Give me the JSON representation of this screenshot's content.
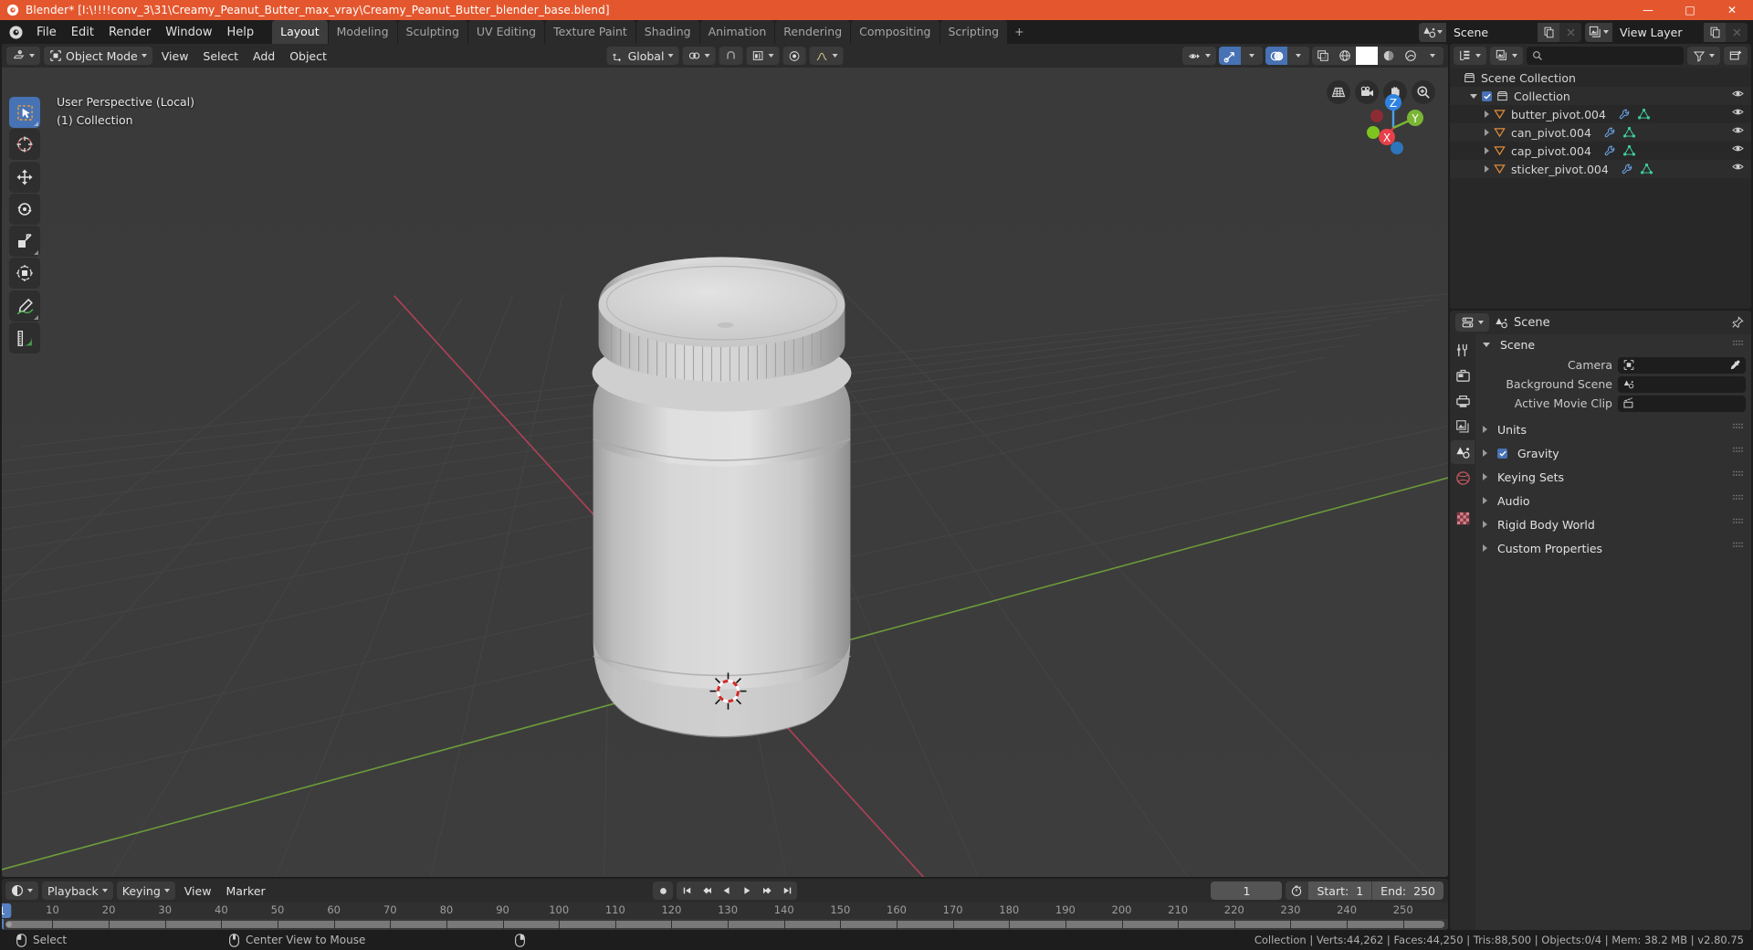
{
  "window": {
    "title": "Blender* [I:\\!!!!conv_3\\31\\Creamy_Peanut_Butter_max_vray\\Creamy_Peanut_Butter_blender_base.blend]",
    "minimize": "—",
    "maximize": "□",
    "close": "✕",
    "accent_color": "#e4572e"
  },
  "topbar": {
    "menus": [
      "File",
      "Edit",
      "Render",
      "Window",
      "Help"
    ],
    "workspaces": [
      {
        "label": "Layout",
        "active": true
      },
      {
        "label": "Modeling",
        "active": false
      },
      {
        "label": "Sculpting",
        "active": false
      },
      {
        "label": "UV Editing",
        "active": false
      },
      {
        "label": "Texture Paint",
        "active": false
      },
      {
        "label": "Shading",
        "active": false
      },
      {
        "label": "Animation",
        "active": false
      },
      {
        "label": "Rendering",
        "active": false
      },
      {
        "label": "Compositing",
        "active": false
      },
      {
        "label": "Scripting",
        "active": false
      }
    ],
    "add_workspace": "+",
    "scene_name": "Scene",
    "view_layer_name": "View Layer"
  },
  "viewport": {
    "mode": "Object Mode",
    "menus": [
      "View",
      "Select",
      "Add",
      "Object"
    ],
    "transform_orientation": "Global",
    "overlay_line1": "User Perspective (Local)",
    "overlay_line2": "(1) Collection",
    "gizmo_axes": [
      "X",
      "Y",
      "Z"
    ],
    "tools": [
      "tweak-select-tool",
      "cursor-tool",
      "move-tool",
      "rotate-tool",
      "scale-tool",
      "transform-tool",
      "annotate-tool",
      "measure-tool"
    ],
    "nav_buttons": [
      "toggle-orthographic",
      "camera-view",
      "pan-view",
      "zoom-view"
    ]
  },
  "outliner": {
    "display_mode": "view-layer",
    "search_placeholder": "",
    "rows": [
      {
        "label": "Scene Collection",
        "indent": 0,
        "icon": "collection-icon",
        "expand": "none",
        "checkbox": false,
        "eye": false,
        "wrench": false,
        "mesh": false
      },
      {
        "label": "Collection",
        "indent": 1,
        "icon": "collection-icon",
        "expand": "down",
        "checkbox": true,
        "eye": true,
        "wrench": false,
        "mesh": false
      },
      {
        "label": "butter_pivot.004",
        "indent": 2,
        "icon": "empty-icon",
        "expand": "right",
        "checkbox": false,
        "eye": true,
        "wrench": true,
        "mesh": true
      },
      {
        "label": "can_pivot.004",
        "indent": 2,
        "icon": "empty-icon",
        "expand": "right",
        "checkbox": false,
        "eye": true,
        "wrench": true,
        "mesh": true
      },
      {
        "label": "cap_pivot.004",
        "indent": 2,
        "icon": "empty-icon",
        "expand": "right",
        "checkbox": false,
        "eye": true,
        "wrench": true,
        "mesh": true
      },
      {
        "label": "sticker_pivot.004",
        "indent": 2,
        "icon": "empty-icon",
        "expand": "right",
        "checkbox": false,
        "eye": true,
        "wrench": true,
        "mesh": true
      }
    ]
  },
  "properties": {
    "breadcrumb": "Scene",
    "panel_title": "Scene",
    "fields": [
      {
        "label": "Camera",
        "value": "",
        "icon": "camera-data-icon",
        "eyedropper": true
      },
      {
        "label": "Background Scene",
        "value": "",
        "icon": "scene-icon",
        "eyedropper": false
      },
      {
        "label": "Active Movie Clip",
        "value": "",
        "icon": "clip-icon",
        "eyedropper": false
      }
    ],
    "sections": [
      {
        "label": "Units",
        "checkbox": false
      },
      {
        "label": "Gravity",
        "checkbox": true
      },
      {
        "label": "Keying Sets",
        "checkbox": false
      },
      {
        "label": "Audio",
        "checkbox": false
      },
      {
        "label": "Rigid Body World",
        "checkbox": false
      },
      {
        "label": "Custom Properties",
        "checkbox": false
      }
    ],
    "tabs": [
      "tool-icon",
      "render-icon",
      "output-icon",
      "view-layer-icon",
      "scene-icon",
      "world-icon",
      "texture-icon"
    ],
    "active_tab_index": 4
  },
  "timeline": {
    "editor_type": "timeline-icon",
    "menus": [
      "Playback",
      "Keying",
      "View",
      "Marker"
    ],
    "current_frame": "1",
    "start_label": "Start:",
    "start_value": "1",
    "end_label": "End:",
    "end_value": "250",
    "ticks": [
      1,
      10,
      20,
      30,
      40,
      50,
      60,
      70,
      80,
      90,
      100,
      110,
      120,
      130,
      140,
      150,
      160,
      170,
      180,
      190,
      200,
      210,
      220,
      230,
      240,
      250
    ],
    "playhead_frame": 1
  },
  "statusbar": {
    "mouse_hints": [
      {
        "icon": "mouse-left-icon",
        "label": "Select"
      },
      {
        "icon": "mouse-middle-icon",
        "label": "Center View to Mouse"
      },
      {
        "icon": "mouse-right-icon",
        "label": ""
      }
    ],
    "stats": "Collection | Verts:44,262 | Faces:44,250 | Tris:88,500 | Objects:0/4 | Mem: 38.2 MB | v2.80.75"
  }
}
